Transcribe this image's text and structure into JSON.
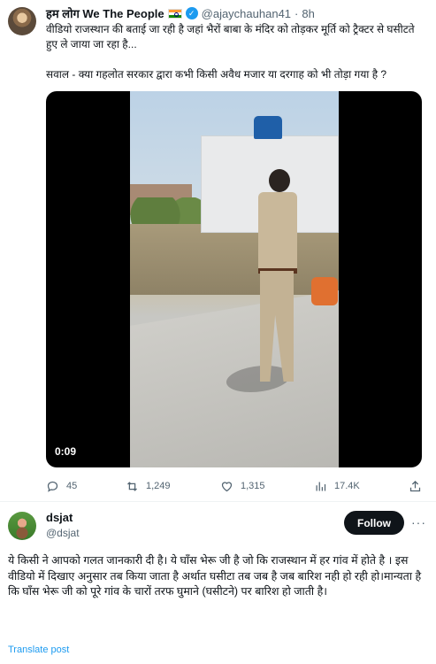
{
  "tweet": {
    "author_name": "हम लोग We The People",
    "handle": "@ajaychauhan41",
    "separator": "·",
    "time": "8h",
    "text_1": "वीडियो राजस्थान की बताई जा रही है जहां भैरों बाबा के मंदिर को तोड़कर मूर्ति को ट्रैक्टर से घसीटते हुए ले जाया जा रहा है...",
    "text_2": "सवाल - क्या गहलोत सरकार द्वारा कभी किसी अवैध मजार या दरगाह को भी तोड़ा गया है ?",
    "video": {
      "timestamp": "0:09"
    },
    "stats": {
      "replies": "45",
      "retweets": "1,249",
      "likes": "1,315",
      "views": "17.4K"
    }
  },
  "reply": {
    "author_name": "dsjat",
    "handle": "@dsjat",
    "follow_label": "Follow",
    "more_label": "···",
    "text": "ये किसी ने आपको गलत जानकारी दी है। ये घाँस भेरू जी है जो कि राजस्थान में हर गांव में होते है । इस वीडियो में दिखाए अनुसार तब किया जाता है अर्थात घसीटा तब जब है जब बारिश नही हो रही हो।मान्यता है कि घाँस भेरू जी को पूरे गांव के चारों तरफ घुमाने (घसीटने) पर बारिश हो जाती है।",
    "translate_label": "Translate post"
  },
  "colors": {
    "accent": "#1d9bf0",
    "text": "#0f1419",
    "muted": "#536471"
  },
  "icons": [
    "verified-badge-icon",
    "india-flag-icon",
    "reply-icon",
    "retweet-icon",
    "like-icon",
    "views-icon",
    "share-icon",
    "more-icon"
  ]
}
